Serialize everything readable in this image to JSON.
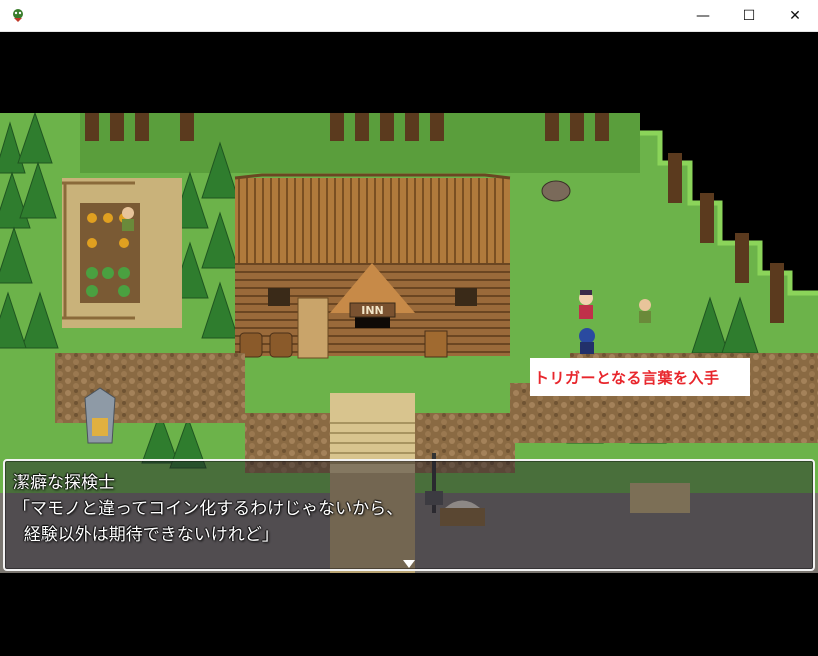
{
  "window": {
    "icon": "game-app-icon",
    "controls": {
      "minimize": "—",
      "maximize": "☐",
      "close": "✕"
    }
  },
  "map": {
    "inn_sign": "INN",
    "trigger_label": "トリガーとなる言葉を入手"
  },
  "message": {
    "speaker": "潔癖な探検士",
    "line1": "「マモノと違ってコイン化するわけじゃないから、",
    "line2": "  経験以外は期待できないけれど」"
  },
  "colors": {
    "grass": "#6cb34a",
    "cliff": "#8a6a43",
    "trigger_text": "#e8262c"
  }
}
